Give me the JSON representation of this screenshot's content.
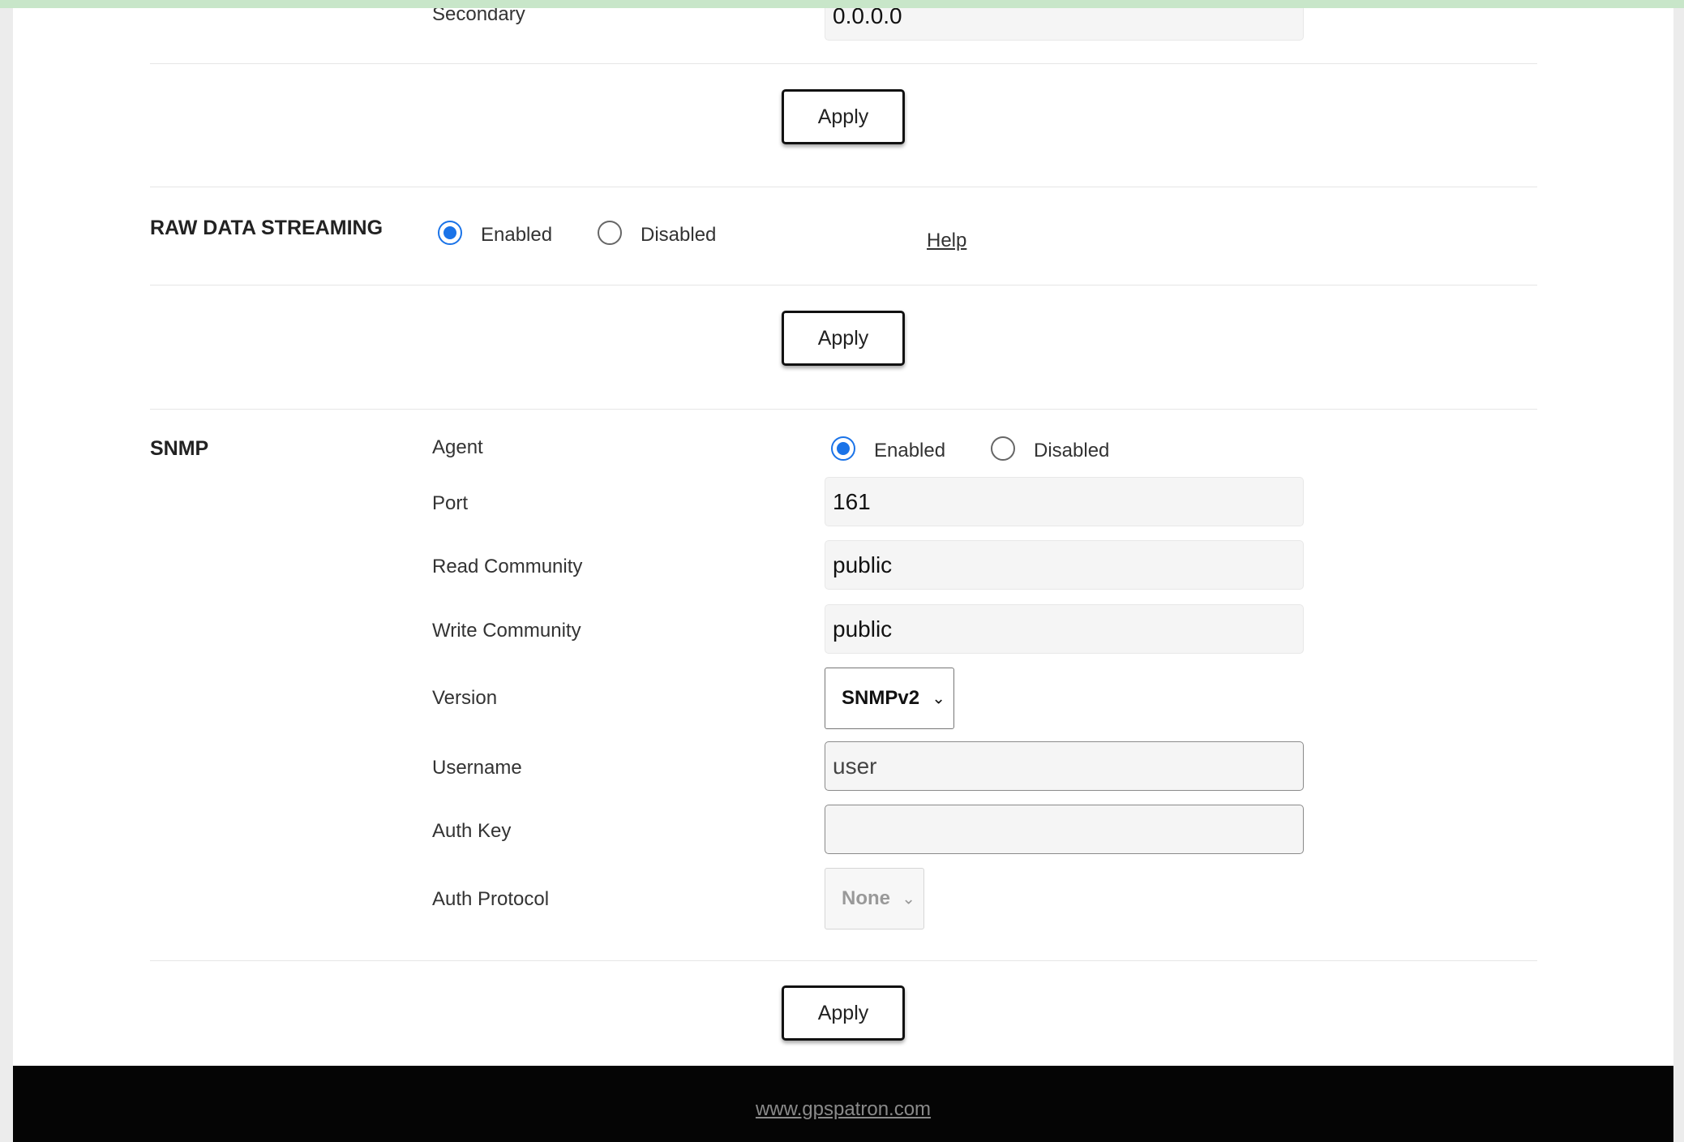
{
  "dns": {
    "secondary_label": "Secondary",
    "secondary_value": "0.0.0.0",
    "apply_label": "Apply"
  },
  "raw_data_streaming": {
    "title": "RAW DATA STREAMING",
    "enabled_label": "Enabled",
    "disabled_label": "Disabled",
    "selected": "Enabled",
    "help_label": "Help",
    "apply_label": "Apply"
  },
  "snmp": {
    "title": "SNMP",
    "agent_label": "Agent",
    "agent_enabled_label": "Enabled",
    "agent_disabled_label": "Disabled",
    "agent_selected": "Enabled",
    "port_label": "Port",
    "port_value": "161",
    "read_community_label": "Read Community",
    "read_community_value": "public",
    "write_community_label": "Write Community",
    "write_community_value": "public",
    "version_label": "Version",
    "version_value": "SNMPv2",
    "username_label": "Username",
    "username_value": "user",
    "auth_key_label": "Auth Key",
    "auth_key_value": "",
    "auth_protocol_label": "Auth Protocol",
    "auth_protocol_value": "None",
    "apply_label": "Apply"
  },
  "footer": {
    "link_text": "www.gpspatron.com"
  },
  "colors": {
    "accent": "#1a73e8",
    "top_bar": "#c8e6c9",
    "footer_bg": "#050505"
  }
}
